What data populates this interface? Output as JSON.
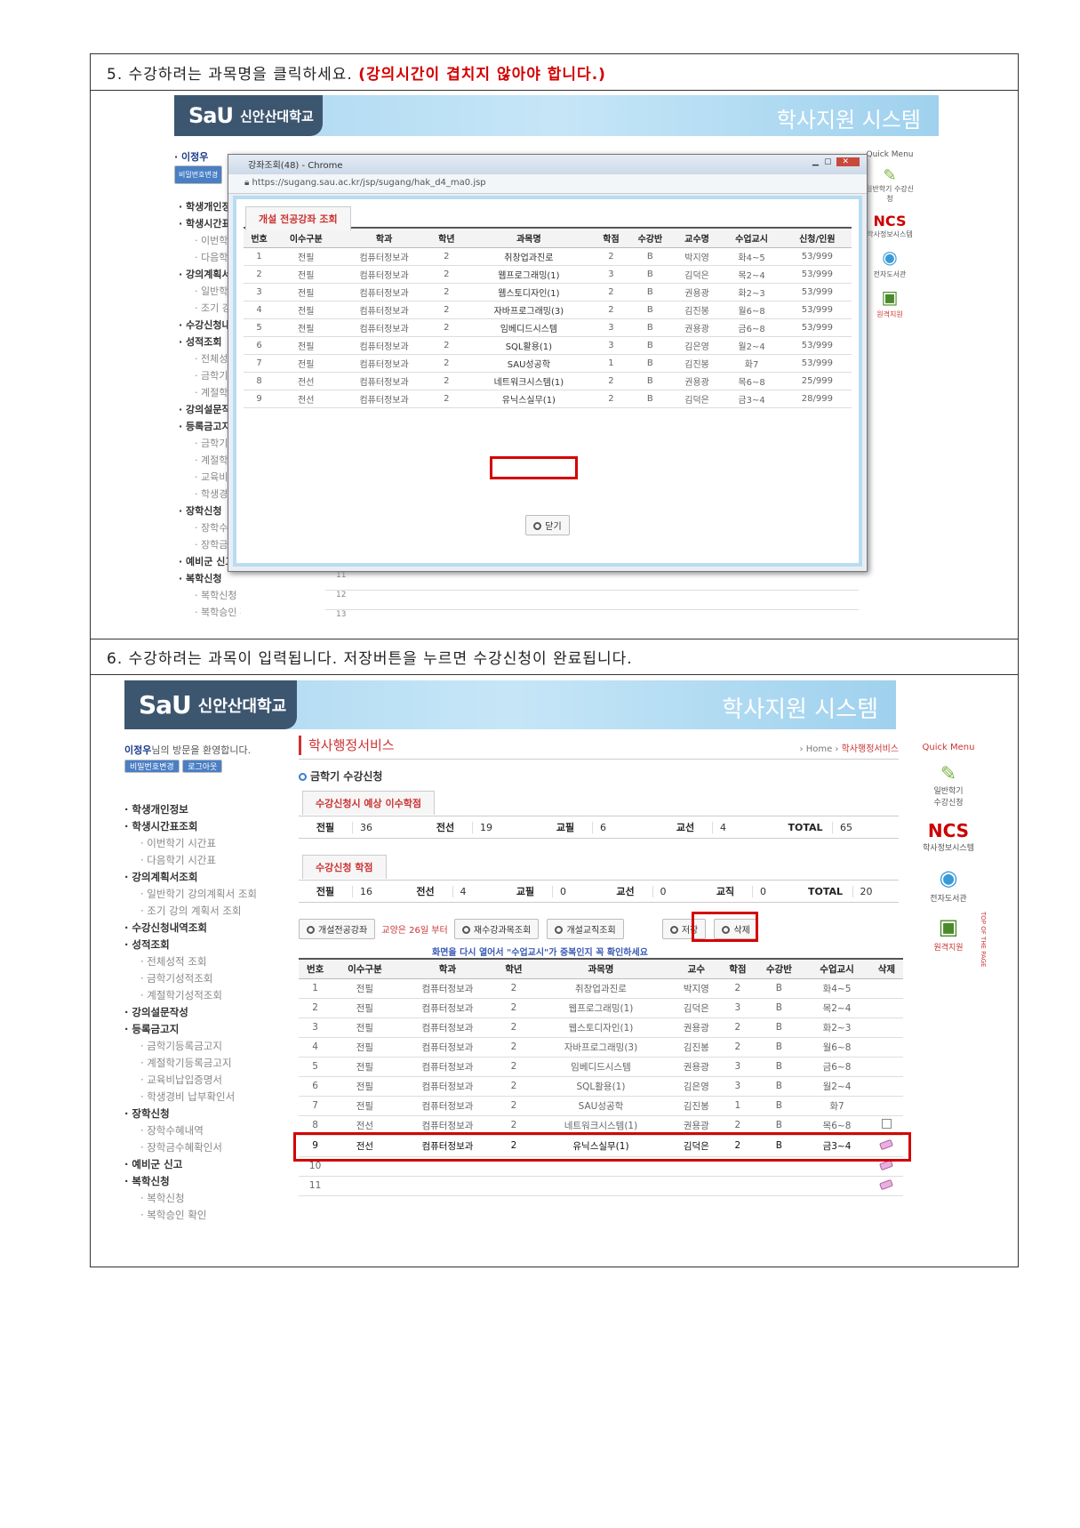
{
  "step5": {
    "label": "5. 수강하려는 과목명을 클릭하세요. ",
    "warning": "(강의시간이 겹치지 않아야 합니다.)"
  },
  "step6": {
    "label": "6. 수강하려는 과목이 입력됩니다. 저장버튼을 누르면 수강신청이 완료됩니다."
  },
  "brand": {
    "logo_mark": "SaU",
    "name": "신안산대학교",
    "system": "학사지원 시스템"
  },
  "user": {
    "welcome_name": "이정우",
    "welcome_text": "님의 방문을 환영합니다.",
    "change_pw": "비밀번호변경",
    "logout": "로그아웃"
  },
  "sidebar": {
    "items": [
      {
        "label": "학생개인정보",
        "level": "main"
      },
      {
        "label": "학생시간표조회",
        "level": "main"
      },
      {
        "label": "이번학기 시간표",
        "level": "sub"
      },
      {
        "label": "다음학기 시간표",
        "level": "sub"
      },
      {
        "label": "강의계획서조회",
        "level": "main"
      },
      {
        "label": "일반학기 강의계획서 조회",
        "level": "sub"
      },
      {
        "label": "조기 강의 계획서 조회",
        "level": "sub"
      },
      {
        "label": "수강신청내역조회",
        "level": "main"
      },
      {
        "label": "성적조회",
        "level": "main"
      },
      {
        "label": "전체성적 조회",
        "level": "sub"
      },
      {
        "label": "금학기성적조회",
        "level": "sub"
      },
      {
        "label": "계절학기성적조회",
        "level": "sub"
      },
      {
        "label": "강의설문작성",
        "level": "main"
      },
      {
        "label": "등록금고지",
        "level": "main"
      },
      {
        "label": "금학기등록금고지",
        "level": "sub"
      },
      {
        "label": "계절학기등록금고지",
        "level": "sub"
      },
      {
        "label": "교육비납입증명서",
        "level": "sub"
      },
      {
        "label": "학생경비 납부확인서",
        "level": "sub"
      },
      {
        "label": "장학신청",
        "level": "main"
      },
      {
        "label": "장학수혜내역",
        "level": "sub"
      },
      {
        "label": "장학금수혜확인서",
        "level": "sub"
      },
      {
        "label": "예비군 신고",
        "level": "main"
      },
      {
        "label": "복학신청",
        "level": "main"
      },
      {
        "label": "복학신청",
        "level": "sub"
      },
      {
        "label": "복학승인 확인",
        "level": "sub"
      }
    ]
  },
  "quickmenu": {
    "title": "Quick Menu",
    "items": [
      "일반학기 수강신청",
      "학사정보시스템",
      "전자도서관",
      "원격지원"
    ],
    "ncs": "NCS",
    "top": "TOP OF THE PAGE"
  },
  "popup": {
    "title": "강좌조회(48) - Chrome",
    "url": "https://sugang.sau.ac.kr/jsp/sugang/hak_d4_ma0.jsp",
    "tab": "개설 전공강좌 조회",
    "columns": [
      "번호",
      "이수구분",
      "학과",
      "학년",
      "과목명",
      "학점",
      "수강반",
      "교수명",
      "수업교시",
      "신청/인원"
    ],
    "rows": [
      [
        "1",
        "전필",
        "컴퓨터정보과",
        "2",
        "취창업과진로",
        "2",
        "B",
        "박지영",
        "화4~5",
        "53/999"
      ],
      [
        "2",
        "전필",
        "컴퓨터정보과",
        "2",
        "웹프로그래밍(1)",
        "3",
        "B",
        "김덕은",
        "목2~4",
        "53/999"
      ],
      [
        "3",
        "전필",
        "컴퓨터정보과",
        "2",
        "웹스토디자인(1)",
        "2",
        "B",
        "권용광",
        "화2~3",
        "53/999"
      ],
      [
        "4",
        "전필",
        "컴퓨터정보과",
        "2",
        "자바프로그래밍(3)",
        "2",
        "B",
        "김진봉",
        "월6~8",
        "53/999"
      ],
      [
        "5",
        "전필",
        "컴퓨터정보과",
        "2",
        "임베디드시스템",
        "3",
        "B",
        "권용광",
        "금6~8",
        "53/999"
      ],
      [
        "6",
        "전필",
        "컴퓨터정보과",
        "2",
        "SQL활용(1)",
        "3",
        "B",
        "김은영",
        "월2~4",
        "53/999"
      ],
      [
        "7",
        "전필",
        "컴퓨터정보과",
        "2",
        "SAU성공학",
        "1",
        "B",
        "김진봉",
        "화7",
        "53/999"
      ],
      [
        "8",
        "전선",
        "컴퓨터정보과",
        "2",
        "네트워크시스템(1)",
        "2",
        "B",
        "권용광",
        "목6~8",
        "25/999"
      ],
      [
        "9",
        "전선",
        "컴퓨터정보과",
        "2",
        "유닉스실무(1)",
        "2",
        "B",
        "김덕은",
        "금3~4",
        "28/999"
      ]
    ],
    "close": "닫기"
  },
  "main": {
    "section_title": "학사행정서비스",
    "breadcrumb_home": "Home",
    "breadcrumb_cur": "학사행정서비스",
    "page_title": "금학기 수강신청",
    "expected_tab": "수강신청시 예상 이수학점",
    "expected": {
      "전필": "36",
      "전선": "19",
      "교필": "6",
      "교선": "4",
      "TOTAL": "65"
    },
    "applied_tab": "수강신청 학점",
    "applied": {
      "전필": "16",
      "전선": "4",
      "교필": "0",
      "교선": "0",
      "교직": "0",
      "TOTAL": "20"
    },
    "buttons": {
      "open_major": "개설전공강좌",
      "notice": "교양은 26일 부터",
      "retake": "재수강과목조회",
      "open_teach": "개설교직조회",
      "save": "저장",
      "delete": "삭제"
    },
    "notice2": "화면을 다시 열어서 \"수업교시\"가 중복인지 꼭 확인하세요",
    "columns": [
      "번호",
      "이수구분",
      "학과",
      "학년",
      "과목명",
      "교수",
      "학점",
      "수강반",
      "수업교시",
      "삭제"
    ],
    "rows": [
      [
        "1",
        "전필",
        "컴퓨터정보과",
        "2",
        "취창업과진로",
        "박지영",
        "2",
        "B",
        "화4~5"
      ],
      [
        "2",
        "전필",
        "컴퓨터정보과",
        "2",
        "웹프로그래밍(1)",
        "김덕은",
        "3",
        "B",
        "목2~4"
      ],
      [
        "3",
        "전필",
        "컴퓨터정보과",
        "2",
        "웹스토디자인(1)",
        "권용광",
        "2",
        "B",
        "화2~3"
      ],
      [
        "4",
        "전필",
        "컴퓨터정보과",
        "2",
        "자바프로그래밍(3)",
        "김진봉",
        "2",
        "B",
        "월6~8"
      ],
      [
        "5",
        "전필",
        "컴퓨터정보과",
        "2",
        "임베디드시스템",
        "권용광",
        "3",
        "B",
        "금6~8"
      ],
      [
        "6",
        "전필",
        "컴퓨터정보과",
        "2",
        "SQL활용(1)",
        "김은영",
        "3",
        "B",
        "월2~4"
      ],
      [
        "7",
        "전필",
        "컴퓨터정보과",
        "2",
        "SAU성공학",
        "김진봉",
        "1",
        "B",
        "화7"
      ],
      [
        "8",
        "전선",
        "컴퓨터정보과",
        "2",
        "네트워크시스템(1)",
        "권용광",
        "2",
        "B",
        "목6~8"
      ],
      [
        "9",
        "전선",
        "컴퓨터정보과",
        "2",
        "유닉스실무(1)",
        "김덕은",
        "2",
        "B",
        "금3~4"
      ],
      [
        "10",
        "",
        "",
        "",
        "",
        "",
        "",
        "",
        ""
      ],
      [
        "11",
        "",
        "",
        "",
        "",
        "",
        "",
        "",
        ""
      ]
    ]
  }
}
